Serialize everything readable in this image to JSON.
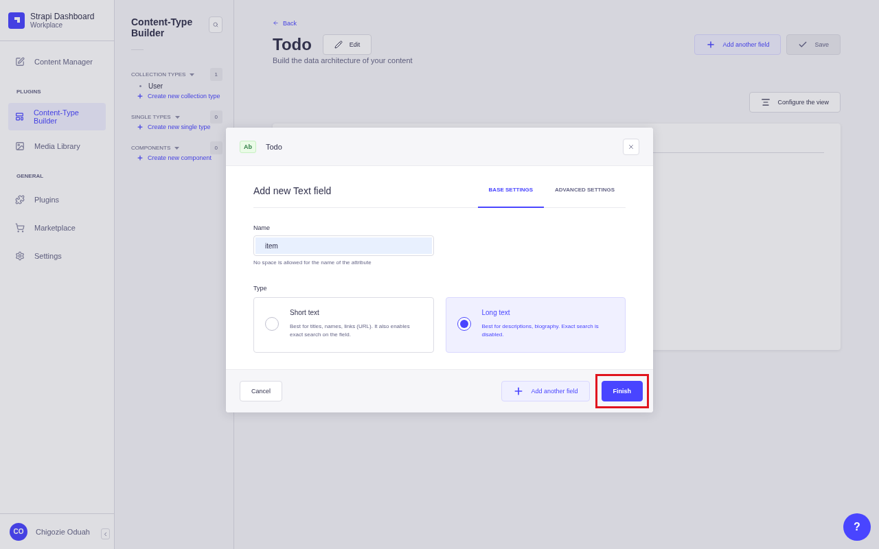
{
  "brand": {
    "title": "Strapi Dashboard",
    "subtitle": "Workplace"
  },
  "nav": [
    {
      "items": [
        {
          "label": "Content Manager",
          "selected": false
        }
      ]
    },
    {
      "heading": "PLUGINS",
      "items": [
        {
          "label": "Content-Type Builder",
          "selected": true
        },
        {
          "label": "Media Library",
          "selected": false
        }
      ]
    },
    {
      "heading": "GENERAL",
      "items": [
        {
          "label": "Plugins",
          "selected": false
        },
        {
          "label": "Marketplace",
          "selected": false
        },
        {
          "label": "Settings",
          "selected": false
        }
      ]
    }
  ],
  "user": {
    "initials": "CO",
    "name": "Chigozie Oduah"
  },
  "builder": {
    "title": "Content-Type Builder",
    "groups": [
      {
        "heading": "COLLECTION TYPES",
        "count": "1",
        "items": [
          "User"
        ],
        "create": "Create new collection type"
      },
      {
        "heading": "SINGLE TYPES",
        "count": "0",
        "create": "Create new single type"
      },
      {
        "heading": "COMPONENTS",
        "count": "0",
        "create": "Create new component"
      }
    ]
  },
  "header": {
    "back": "Back",
    "title": "Todo",
    "edit": "Edit",
    "subtitle": "Build the data architecture of your content",
    "add_field": "Add another field",
    "save": "Save",
    "configure": "Configure the view"
  },
  "modal": {
    "badge": "Ab",
    "title": "Todo",
    "heading": "Add new Text field",
    "tabs": [
      {
        "label": "BASE SETTINGS",
        "selected": true
      },
      {
        "label": "ADVANCED SETTINGS",
        "selected": false
      }
    ],
    "name_label": "Name",
    "name_value": "item",
    "hint": "No space is allowed for the name of the attribute",
    "type_label": "Type",
    "options": [
      {
        "title": "Short text",
        "description": "Best for titles, names, links (URL). It also enables exact search on the field.",
        "selected": false
      },
      {
        "title": "Long text",
        "description": "Best for descriptions, biography. Exact search is disabled.",
        "selected": true
      }
    ],
    "cancel": "Cancel",
    "add_field": "Add another field",
    "finish": "Finish",
    "finish_highlighted": true
  },
  "help": "?"
}
